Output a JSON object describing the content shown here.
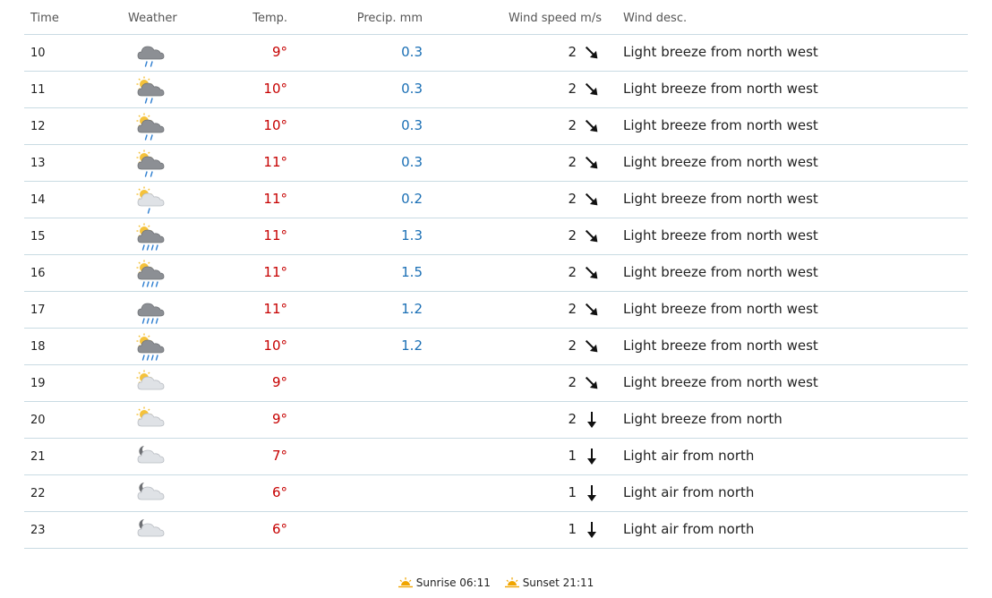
{
  "headers": {
    "time": "Time",
    "weather": "Weather",
    "temp": "Temp.",
    "precip": "Precip. mm",
    "wind_speed": "Wind speed m/s",
    "wind_desc": "Wind desc."
  },
  "rows": [
    {
      "time": "10",
      "icon": "cloud-rain-icon",
      "temp": "9°",
      "precip": "0.3",
      "wind": "2",
      "desc": "Light breeze from north west"
    },
    {
      "time": "11",
      "icon": "partly-sunny-rain-icon",
      "temp": "10°",
      "precip": "0.3",
      "wind": "2",
      "desc": "Light breeze from north west"
    },
    {
      "time": "12",
      "icon": "partly-sunny-rain-icon",
      "temp": "10°",
      "precip": "0.3",
      "wind": "2",
      "desc": "Light breeze from north west"
    },
    {
      "time": "13",
      "icon": "partly-sunny-rain-icon",
      "temp": "11°",
      "precip": "0.3",
      "wind": "2",
      "desc": "Light breeze from north west"
    },
    {
      "time": "14",
      "icon": "partly-sunny-light-rain-icon",
      "temp": "11°",
      "precip": "0.2",
      "wind": "2",
      "desc": "Light breeze from north west"
    },
    {
      "time": "15",
      "icon": "partly-sunny-heavy-rain-icon",
      "temp": "11°",
      "precip": "1.3",
      "wind": "2",
      "desc": "Light breeze from north west"
    },
    {
      "time": "16",
      "icon": "partly-sunny-heavy-rain-icon",
      "temp": "11°",
      "precip": "1.5",
      "wind": "2",
      "desc": "Light breeze from north west"
    },
    {
      "time": "17",
      "icon": "cloud-heavy-rain-icon",
      "temp": "11°",
      "precip": "1.2",
      "wind": "2",
      "desc": "Light breeze from north west"
    },
    {
      "time": "18",
      "icon": "partly-sunny-heavy-rain-icon",
      "temp": "10°",
      "precip": "1.2",
      "wind": "2",
      "desc": "Light breeze from north west"
    },
    {
      "time": "19",
      "icon": "partly-cloudy-day-icon",
      "temp": "9°",
      "precip": "",
      "wind": "2",
      "desc": "Light breeze from north west"
    },
    {
      "time": "20",
      "icon": "partly-cloudy-day-icon",
      "temp": "9°",
      "precip": "",
      "wind": "2",
      "desc": "Light breeze from north"
    },
    {
      "time": "21",
      "icon": "partly-cloudy-night-icon",
      "temp": "7°",
      "precip": "",
      "wind": "1",
      "desc": "Light air from north"
    },
    {
      "time": "22",
      "icon": "partly-cloudy-night-icon",
      "temp": "6°",
      "precip": "",
      "wind": "1",
      "desc": "Light air from north"
    },
    {
      "time": "23",
      "icon": "partly-cloudy-night-icon",
      "temp": "6°",
      "precip": "",
      "wind": "1",
      "desc": "Light air from north"
    }
  ],
  "wind_directions": [
    "north-west",
    "north-west",
    "north-west",
    "north-west",
    "north-west",
    "north-west",
    "north-west",
    "north-west",
    "north-west",
    "north-west",
    "north",
    "north",
    "north",
    "north"
  ],
  "sun": {
    "sunrise_label": "Sunrise 06:11",
    "sunset_label": "Sunset 21:11"
  },
  "colors": {
    "temp": "#c60000",
    "precip": "#1a6fb5",
    "divider": "#c9dbe3",
    "sun": "#f0a500"
  }
}
